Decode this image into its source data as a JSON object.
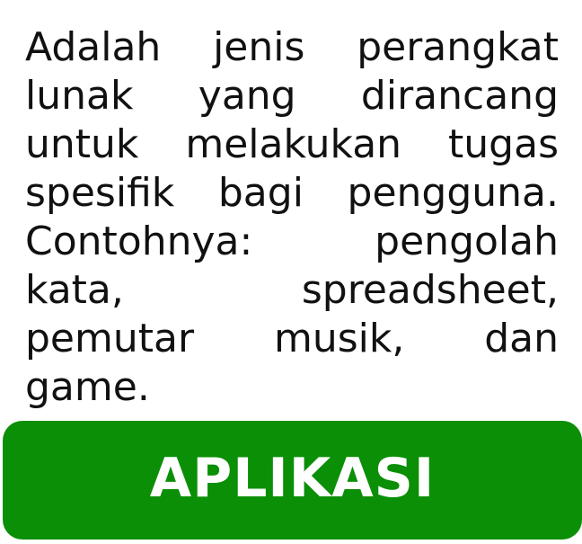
{
  "card": {
    "description": "Adalah jenis perangkat lunak yang dirancang untuk melakukan tugas spesifik bagi pengguna. Contohnya: pengolah kata, spreadsheet, pemutar musik, dan game.",
    "answer": "APLIKASI"
  },
  "colors": {
    "background": "#ffffff",
    "text": "#111111",
    "answer_background": "#0a8f06",
    "answer_text": "#ffffff"
  }
}
